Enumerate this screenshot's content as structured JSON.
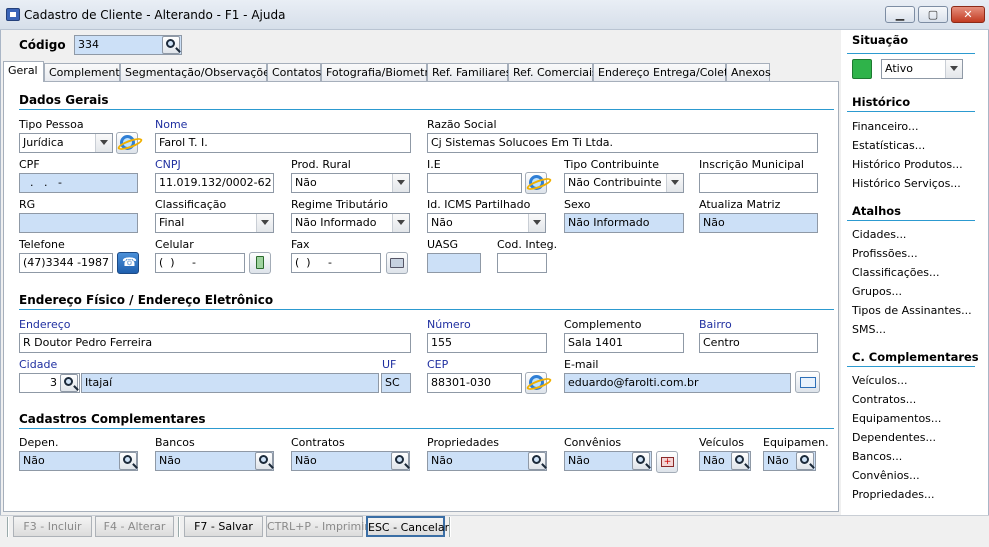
{
  "window": {
    "title": "Cadastro de Cliente - Alterando - F1 - Ajuda"
  },
  "codigo": {
    "label": "Código",
    "value": "334"
  },
  "tabs": [
    "Geral",
    "Complemento",
    "Segmentação/Observações",
    "Contatos",
    "Fotografia/Biometria",
    "Ref. Familiares",
    "Ref. Comerciais",
    "Endereço Entrega/Coleta",
    "Anexos"
  ],
  "dados_gerais": {
    "title": "Dados Gerais",
    "tipo_pessoa": {
      "label": "Tipo Pessoa",
      "value": "Jurídica"
    },
    "nome": {
      "label": "Nome",
      "value": "Farol T. I."
    },
    "razao_social": {
      "label": "Razão Social",
      "value": "Cj Sistemas Solucoes Em Ti Ltda."
    },
    "cpf": {
      "label": "CPF",
      "value": "  .   .   -"
    },
    "cnpj": {
      "label": "CNPJ",
      "value": "11.019.132/0002-62"
    },
    "prod_rural": {
      "label": "Prod. Rural",
      "value": "Não"
    },
    "ie": {
      "label": "I.E",
      "value": ""
    },
    "tipo_contribuinte": {
      "label": "Tipo Contribuinte",
      "value": "Não Contribuinte"
    },
    "inscricao_municipal": {
      "label": "Inscrição Municipal",
      "value": ""
    },
    "rg": {
      "label": "RG",
      "value": ""
    },
    "classificacao": {
      "label": "Classificação",
      "value": "Final"
    },
    "regime_tributario": {
      "label": "Regime Tributário",
      "value": "Não Informado"
    },
    "id_icms": {
      "label": "Id. ICMS Partilhado",
      "value": "Não"
    },
    "sexo": {
      "label": "Sexo",
      "value": "Não Informado"
    },
    "atualiza_matriz": {
      "label": "Atualiza Matriz",
      "value": "Não"
    },
    "telefone": {
      "label": "Telefone",
      "value": "(47)3344 -1987"
    },
    "celular": {
      "label": "Celular",
      "value": "(  )     -"
    },
    "fax": {
      "label": "Fax",
      "value": "(  )     -"
    },
    "uasg": {
      "label": "UASG",
      "value": ""
    },
    "cod_integ": {
      "label": "Cod. Integ.",
      "value": ""
    }
  },
  "endereco": {
    "title": "Endereço Físico / Endereço Eletrônico",
    "endereco": {
      "label": "Endereço",
      "value": "R Doutor Pedro Ferreira"
    },
    "numero": {
      "label": "Número",
      "value": "155"
    },
    "complemento": {
      "label": "Complemento",
      "value": "Sala 1401"
    },
    "bairro": {
      "label": "Bairro",
      "value": "Centro"
    },
    "cidade": {
      "label": "Cidade",
      "code": "3",
      "name": "Itajaí"
    },
    "uf": {
      "label": "UF",
      "value": "SC"
    },
    "cep": {
      "label": "CEP",
      "value": "88301-030"
    },
    "email": {
      "label": "E-mail",
      "value": "eduardo@farolti.com.br"
    }
  },
  "complementares": {
    "title": "Cadastros Complementares",
    "depen": {
      "label": "Depen.",
      "value": "Não"
    },
    "bancos": {
      "label": "Bancos",
      "value": "Não"
    },
    "contratos": {
      "label": "Contratos",
      "value": "Não"
    },
    "propriedades": {
      "label": "Propriedades",
      "value": "Não"
    },
    "convenios": {
      "label": "Convênios",
      "value": "Não"
    },
    "veiculos": {
      "label": "Veículos",
      "value": "Não"
    },
    "equipamen": {
      "label": "Equipamen.",
      "value": "Não"
    }
  },
  "sidebar": {
    "situacao": {
      "title": "Situação",
      "value": "Ativo",
      "color": "#2fb34a"
    },
    "historico": {
      "title": "Histórico",
      "items": [
        "Financeiro...",
        "Estatísticas...",
        "Histórico Produtos...",
        "Histórico Serviços..."
      ]
    },
    "atalhos": {
      "title": "Atalhos",
      "items": [
        "Cidades...",
        "Profissões...",
        "Classificações...",
        "Grupos...",
        "Tipos de Assinantes...",
        "SMS..."
      ]
    },
    "c_complementares": {
      "title": "C. Complementares",
      "items": [
        "Veículos...",
        "Contratos...",
        "Equipamentos...",
        "Dependentes...",
        "Bancos...",
        "Convênios...",
        "Propriedades..."
      ]
    }
  },
  "footer": {
    "incluir": "F3 - Incluir",
    "alterar": "F4 - Alterar",
    "salvar": "F7 - Salvar",
    "imprimir": "CTRL+P - Imprimir",
    "cancelar": "ESC - Cancelar"
  }
}
